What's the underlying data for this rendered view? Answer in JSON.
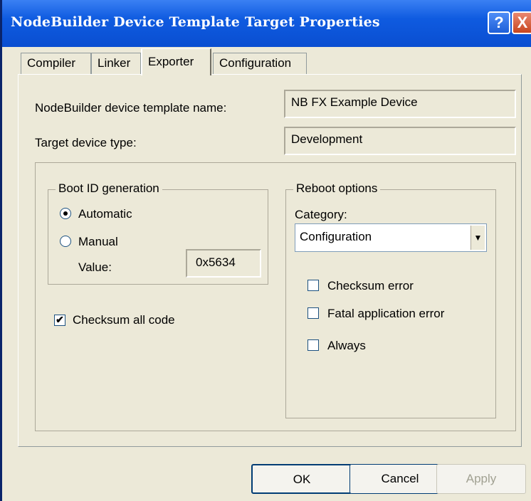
{
  "window": {
    "title": "NodeBuilder Device Template Target Properties"
  },
  "titlebar": {
    "help_label": "?",
    "close_label": "X"
  },
  "tabs": [
    {
      "label": "Compiler"
    },
    {
      "label": "Linker"
    },
    {
      "label": "Exporter",
      "active": true
    },
    {
      "label": "Configuration"
    }
  ],
  "fields": {
    "template_name_label": "NodeBuilder device template name:",
    "template_name_value": "NB FX Example Device",
    "device_type_label": "Target device type:",
    "device_type_value": "Development"
  },
  "boot_id": {
    "title": "Boot ID generation",
    "automatic_label": "Automatic",
    "manual_label": "Manual",
    "value_label": "Value:",
    "value": "0x5634",
    "selected": "Automatic"
  },
  "checksum_all": {
    "label": "Checksum all code",
    "checked": true
  },
  "reboot": {
    "title": "Reboot options",
    "category_label": "Category:",
    "category_value": "Configuration",
    "options": [
      {
        "label": "Checksum error",
        "checked": false
      },
      {
        "label": "Fatal application error",
        "checked": false
      },
      {
        "label": "Always",
        "checked": false
      }
    ]
  },
  "buttons": {
    "ok": "OK",
    "cancel": "Cancel",
    "apply": "Apply"
  }
}
